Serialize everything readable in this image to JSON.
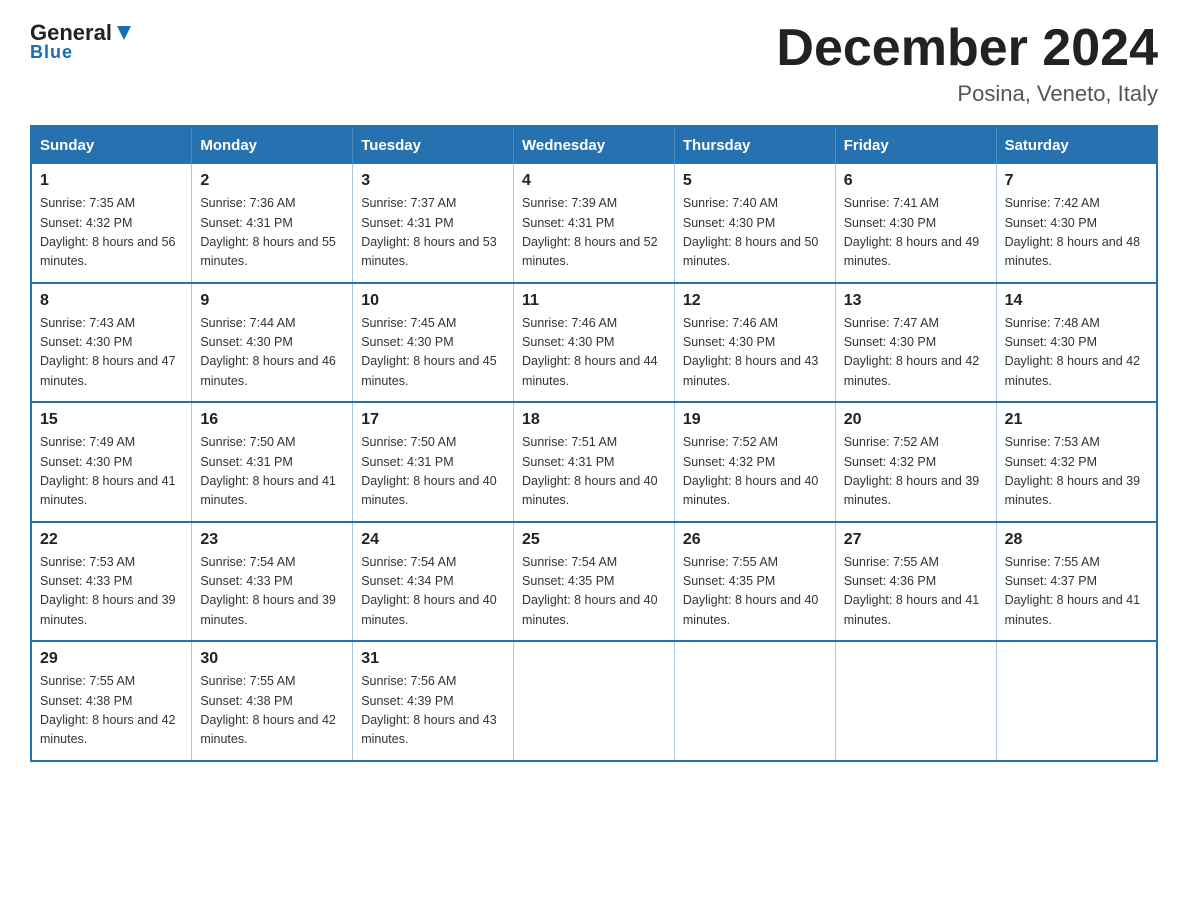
{
  "header": {
    "logo_general": "General",
    "logo_blue": "Blue",
    "month_title": "December 2024",
    "location": "Posina, Veneto, Italy"
  },
  "days_of_week": [
    "Sunday",
    "Monday",
    "Tuesday",
    "Wednesday",
    "Thursday",
    "Friday",
    "Saturday"
  ],
  "weeks": [
    [
      {
        "day": "1",
        "sunrise": "7:35 AM",
        "sunset": "4:32 PM",
        "daylight": "8 hours and 56 minutes."
      },
      {
        "day": "2",
        "sunrise": "7:36 AM",
        "sunset": "4:31 PM",
        "daylight": "8 hours and 55 minutes."
      },
      {
        "day": "3",
        "sunrise": "7:37 AM",
        "sunset": "4:31 PM",
        "daylight": "8 hours and 53 minutes."
      },
      {
        "day": "4",
        "sunrise": "7:39 AM",
        "sunset": "4:31 PM",
        "daylight": "8 hours and 52 minutes."
      },
      {
        "day": "5",
        "sunrise": "7:40 AM",
        "sunset": "4:30 PM",
        "daylight": "8 hours and 50 minutes."
      },
      {
        "day": "6",
        "sunrise": "7:41 AM",
        "sunset": "4:30 PM",
        "daylight": "8 hours and 49 minutes."
      },
      {
        "day": "7",
        "sunrise": "7:42 AM",
        "sunset": "4:30 PM",
        "daylight": "8 hours and 48 minutes."
      }
    ],
    [
      {
        "day": "8",
        "sunrise": "7:43 AM",
        "sunset": "4:30 PM",
        "daylight": "8 hours and 47 minutes."
      },
      {
        "day": "9",
        "sunrise": "7:44 AM",
        "sunset": "4:30 PM",
        "daylight": "8 hours and 46 minutes."
      },
      {
        "day": "10",
        "sunrise": "7:45 AM",
        "sunset": "4:30 PM",
        "daylight": "8 hours and 45 minutes."
      },
      {
        "day": "11",
        "sunrise": "7:46 AM",
        "sunset": "4:30 PM",
        "daylight": "8 hours and 44 minutes."
      },
      {
        "day": "12",
        "sunrise": "7:46 AM",
        "sunset": "4:30 PM",
        "daylight": "8 hours and 43 minutes."
      },
      {
        "day": "13",
        "sunrise": "7:47 AM",
        "sunset": "4:30 PM",
        "daylight": "8 hours and 42 minutes."
      },
      {
        "day": "14",
        "sunrise": "7:48 AM",
        "sunset": "4:30 PM",
        "daylight": "8 hours and 42 minutes."
      }
    ],
    [
      {
        "day": "15",
        "sunrise": "7:49 AM",
        "sunset": "4:30 PM",
        "daylight": "8 hours and 41 minutes."
      },
      {
        "day": "16",
        "sunrise": "7:50 AM",
        "sunset": "4:31 PM",
        "daylight": "8 hours and 41 minutes."
      },
      {
        "day": "17",
        "sunrise": "7:50 AM",
        "sunset": "4:31 PM",
        "daylight": "8 hours and 40 minutes."
      },
      {
        "day": "18",
        "sunrise": "7:51 AM",
        "sunset": "4:31 PM",
        "daylight": "8 hours and 40 minutes."
      },
      {
        "day": "19",
        "sunrise": "7:52 AM",
        "sunset": "4:32 PM",
        "daylight": "8 hours and 40 minutes."
      },
      {
        "day": "20",
        "sunrise": "7:52 AM",
        "sunset": "4:32 PM",
        "daylight": "8 hours and 39 minutes."
      },
      {
        "day": "21",
        "sunrise": "7:53 AM",
        "sunset": "4:32 PM",
        "daylight": "8 hours and 39 minutes."
      }
    ],
    [
      {
        "day": "22",
        "sunrise": "7:53 AM",
        "sunset": "4:33 PM",
        "daylight": "8 hours and 39 minutes."
      },
      {
        "day": "23",
        "sunrise": "7:54 AM",
        "sunset": "4:33 PM",
        "daylight": "8 hours and 39 minutes."
      },
      {
        "day": "24",
        "sunrise": "7:54 AM",
        "sunset": "4:34 PM",
        "daylight": "8 hours and 40 minutes."
      },
      {
        "day": "25",
        "sunrise": "7:54 AM",
        "sunset": "4:35 PM",
        "daylight": "8 hours and 40 minutes."
      },
      {
        "day": "26",
        "sunrise": "7:55 AM",
        "sunset": "4:35 PM",
        "daylight": "8 hours and 40 minutes."
      },
      {
        "day": "27",
        "sunrise": "7:55 AM",
        "sunset": "4:36 PM",
        "daylight": "8 hours and 41 minutes."
      },
      {
        "day": "28",
        "sunrise": "7:55 AM",
        "sunset": "4:37 PM",
        "daylight": "8 hours and 41 minutes."
      }
    ],
    [
      {
        "day": "29",
        "sunrise": "7:55 AM",
        "sunset": "4:38 PM",
        "daylight": "8 hours and 42 minutes."
      },
      {
        "day": "30",
        "sunrise": "7:55 AM",
        "sunset": "4:38 PM",
        "daylight": "8 hours and 42 minutes."
      },
      {
        "day": "31",
        "sunrise": "7:56 AM",
        "sunset": "4:39 PM",
        "daylight": "8 hours and 43 minutes."
      },
      null,
      null,
      null,
      null
    ]
  ]
}
